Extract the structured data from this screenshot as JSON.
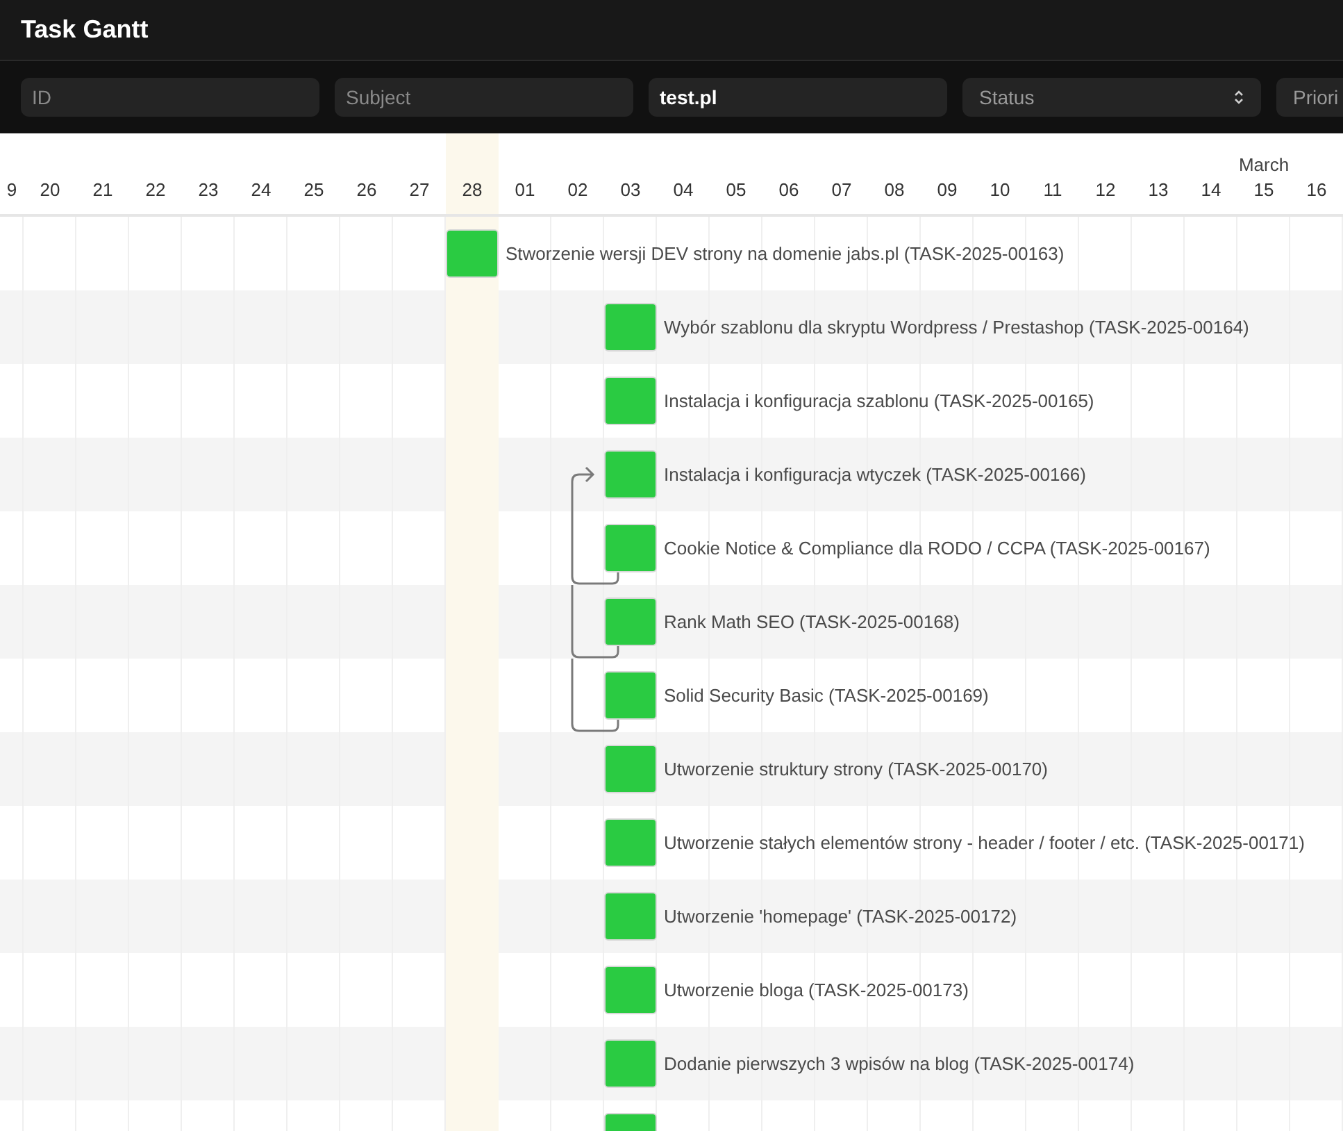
{
  "window": {
    "title": "Task Gantt"
  },
  "filters": [
    {
      "kind": "text",
      "placeholder": "ID"
    },
    {
      "kind": "text",
      "placeholder": "Subject"
    },
    {
      "kind": "text",
      "value": "test.pl"
    },
    {
      "kind": "select",
      "placeholder": "Status"
    },
    {
      "kind": "select",
      "placeholder": "Priori"
    }
  ],
  "timeline": {
    "month_label": "March",
    "days": [
      {
        "label": "9",
        "today": false
      },
      {
        "label": "20",
        "today": false
      },
      {
        "label": "21",
        "today": false
      },
      {
        "label": "22",
        "today": false
      },
      {
        "label": "23",
        "today": false
      },
      {
        "label": "24",
        "today": false
      },
      {
        "label": "25",
        "today": false
      },
      {
        "label": "26",
        "today": false
      },
      {
        "label": "27",
        "today": false
      },
      {
        "label": "28",
        "today": true,
        "tasks": [
          {
            "label": "Stworzenie wersji DEV strony na domenie jabs.pl (TASK-2025-00163)",
            "arrow_in": false,
            "link_out": false
          }
        ]
      },
      {
        "label": "01",
        "today": false
      },
      {
        "label": "02",
        "today": false
      },
      {
        "label": "03",
        "today": false,
        "tasks": [
          {
            "label": "Wybór szablonu dla skryptu Wordpress / Prestashop (TASK-2025-00164)",
            "arrow_in": false,
            "link_out": false
          },
          {
            "label": "Instalacja i konfiguracja szablonu (TASK-2025-00165)",
            "arrow_in": false,
            "link_out": false
          },
          {
            "label": "Instalacja i konfiguracja wtyczek (TASK-2025-00166)",
            "arrow_in": true,
            "link_out": false
          },
          {
            "label": "Cookie Notice & Compliance dla RODO / CCPA (TASK-2025-00167)",
            "arrow_in": false,
            "link_out": true
          },
          {
            "label": "Rank Math SEO (TASK-2025-00168)",
            "arrow_in": false,
            "link_out": true
          },
          {
            "label": "Solid Security Basic (TASK-2025-00169)",
            "arrow_in": false,
            "link_out": true
          },
          {
            "label": "Utworzenie struktury strony (TASK-2025-00170)",
            "arrow_in": false,
            "link_out": false
          },
          {
            "label": "Utworzenie stałych elementów strony - header / footer / etc. (TASK-2025-00171)",
            "arrow_in": false,
            "link_out": false
          },
          {
            "label": "Utworzenie 'homepage' (TASK-2025-00172)",
            "arrow_in": false,
            "link_out": false
          },
          {
            "label": "Utworzenie bloga (TASK-2025-00173)",
            "arrow_in": false,
            "link_out": false
          },
          {
            "label": "Dodanie pierwszych 3 wpisów na blog (TASK-2025-00174)",
            "arrow_in": false,
            "link_out": false
          },
          {
            "arrow_in": false,
            "link_out": false
          }
        ]
      },
      {
        "label": "04",
        "today": false
      },
      {
        "label": "05",
        "today": false
      },
      {
        "label": "06",
        "today": false
      },
      {
        "label": "07",
        "today": false
      },
      {
        "label": "08",
        "today": false
      },
      {
        "label": "09",
        "today": false
      },
      {
        "label": "10",
        "today": false
      },
      {
        "label": "11",
        "today": false
      },
      {
        "label": "12",
        "today": false
      },
      {
        "label": "13",
        "today": false
      },
      {
        "label": "14",
        "today": false
      },
      {
        "label": "15",
        "today": false
      },
      {
        "label": "16",
        "today": false
      }
    ]
  }
}
